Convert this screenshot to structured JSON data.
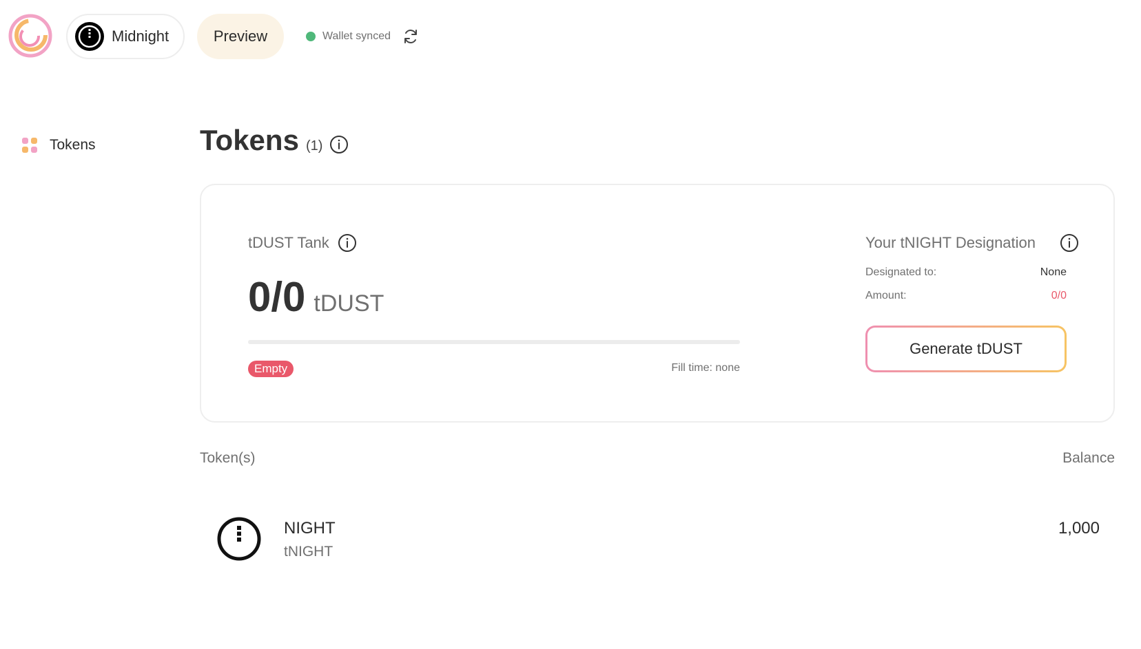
{
  "header": {
    "network": {
      "label": "Midnight",
      "icon": "midnight-logo-icon"
    },
    "preview_label": "Preview",
    "sync": {
      "text": "Wallet synced",
      "status_color": "#4fb87a",
      "icon": "refresh-icon"
    }
  },
  "sidebar": {
    "items": [
      {
        "label": "Tokens",
        "icon": "grid-dots-icon",
        "active": true
      }
    ]
  },
  "page": {
    "title": "Tokens",
    "count": "(1)"
  },
  "tank": {
    "title": "tDUST Tank",
    "value": "0/0",
    "unit": "tDUST",
    "fill_fraction": 0,
    "status": "Empty",
    "fill_time": "Fill time: none"
  },
  "designation": {
    "title": "Your tNIGHT Designation",
    "designated_label": "Designated to:",
    "designated_value": "None",
    "amount_label": "Amount:",
    "amount_value": "0/0",
    "generate_label": "Generate tDUST"
  },
  "table": {
    "columns": [
      "Token(s)",
      "Balance"
    ],
    "rows": [
      {
        "name": "NIGHT",
        "symbol": "tNIGHT",
        "balance": "1,000",
        "icon": "night-token-icon"
      }
    ]
  },
  "colors": {
    "accent_red": "#e9586a",
    "sync_green": "#4fb87a",
    "preview_bg": "#fbf3e5",
    "gradient_pink": "#ef8fb0",
    "gradient_yellow": "#f7c463"
  }
}
